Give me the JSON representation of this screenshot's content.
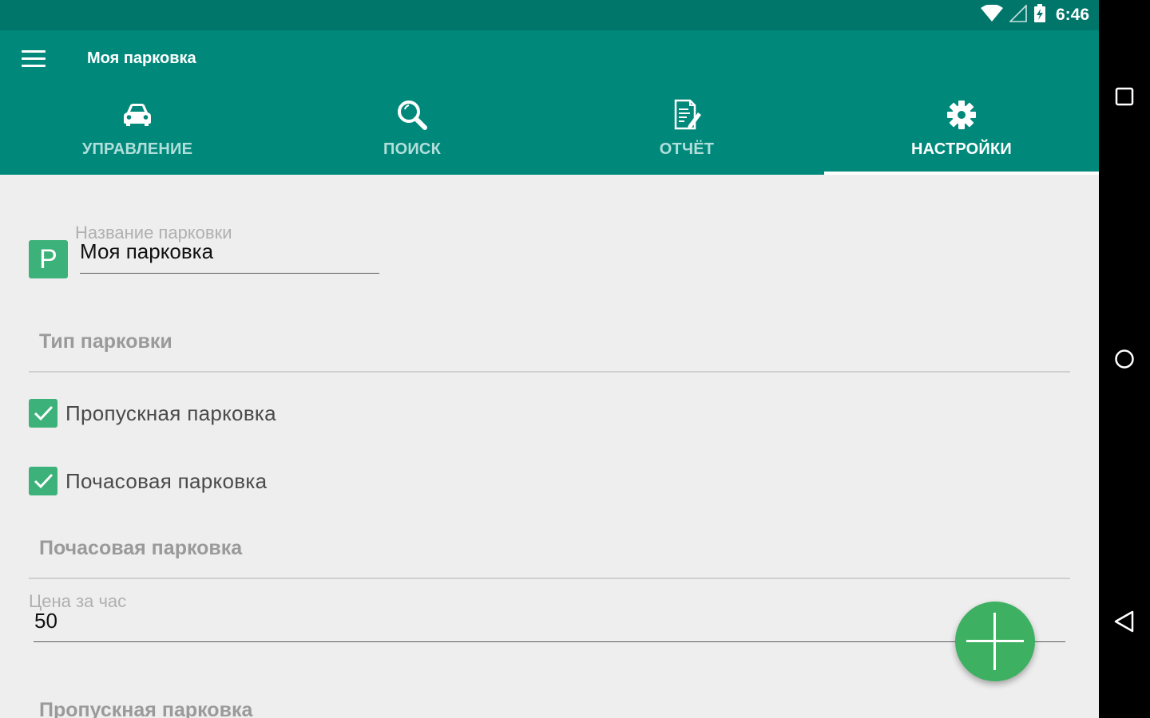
{
  "status_bar": {
    "time": "6:46",
    "icons": [
      "wifi-icon",
      "cell-signal-icon",
      "battery-icon"
    ]
  },
  "app_bar": {
    "title": "Моя парковка",
    "menu_icon": "hamburger-menu-icon"
  },
  "tabs": [
    {
      "label": "УПРАВЛЕНИЕ",
      "icon": "car-icon",
      "active": false
    },
    {
      "label": "ПОИСК",
      "icon": "search-icon",
      "active": false
    },
    {
      "label": "ОТЧЁТ",
      "icon": "report-icon",
      "active": false
    },
    {
      "label": "НАСТРОЙКИ",
      "icon": "gear-icon",
      "active": true
    }
  ],
  "settings": {
    "logo_letter": "P",
    "parking_name": {
      "label": "Название парковки",
      "value": "Моя парковка"
    },
    "parking_type_title": "Тип парковки",
    "options": [
      {
        "label": "Пропускная парковка",
        "checked": true
      },
      {
        "label": "Почасовая парковка",
        "checked": true
      }
    ],
    "hourly_section_title": "Почасовая парковка",
    "price_per_hour": {
      "label": "Цена за час",
      "value": "50"
    },
    "pass_section_title": "Пропускная парковка"
  },
  "fab": {
    "icon": "plus-icon"
  },
  "nav_bar": {
    "buttons": [
      "recents-icon",
      "home-icon",
      "back-icon"
    ]
  },
  "colors": {
    "primary": "#00897b",
    "primary_dark": "#00766b",
    "accent": "#3db17a",
    "background": "#eeeeee"
  }
}
